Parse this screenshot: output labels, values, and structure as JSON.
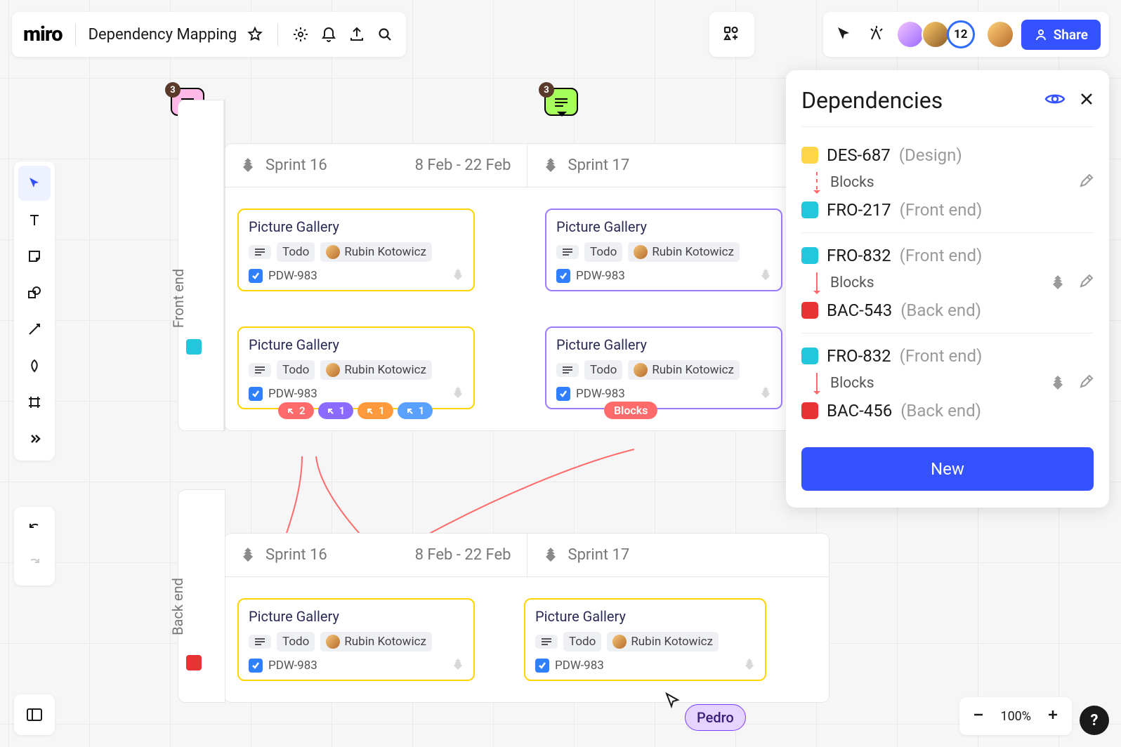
{
  "header": {
    "logo": "miro",
    "board_title": "Dependency Mapping",
    "share_label": "Share",
    "participant_overflow": "12"
  },
  "comments": [
    {
      "id": "comment-pink",
      "count": "3"
    },
    {
      "id": "comment-green",
      "count": "3"
    }
  ],
  "lanes": {
    "front_end": {
      "label": "Front end",
      "sprints": [
        {
          "name": "Sprint 16",
          "dates": "8 Feb - 22 Feb"
        },
        {
          "name": "Sprint 17",
          "dates": ""
        }
      ]
    },
    "back_end": {
      "label": "Back end",
      "sprints": [
        {
          "name": "Sprint 16",
          "dates": "8 Feb - 22 Feb"
        },
        {
          "name": "Sprint 17",
          "dates": ""
        }
      ]
    }
  },
  "cards": {
    "fe_s16_a": {
      "title": "Picture Gallery",
      "status": "Todo",
      "assignee": "Rubin Kotowicz",
      "key": "PDW-983"
    },
    "fe_s16_b": {
      "title": "Picture Gallery",
      "status": "Todo",
      "assignee": "Rubin Kotowicz",
      "key": "PDW-983",
      "pills": [
        {
          "count": "2",
          "color": "#ff6b6b"
        },
        {
          "count": "1",
          "color": "#8b6bff"
        },
        {
          "count": "1",
          "color": "#ff9a3c"
        },
        {
          "count": "1",
          "color": "#5aa0ff"
        }
      ]
    },
    "fe_s17_a": {
      "title": "Picture Gallery",
      "status": "Todo",
      "assignee": "Rubin Kotowicz",
      "key": "PDW-983"
    },
    "fe_s17_b": {
      "title": "Picture Gallery",
      "status": "Todo",
      "assignee": "Rubin Kotowicz",
      "key": "PDW-983",
      "blocks_label": "Blocks"
    },
    "be_s16_a": {
      "title": "Picture Gallery",
      "status": "Todo",
      "assignee": "Rubin Kotowicz",
      "key": "PDW-983"
    },
    "be_s17_a": {
      "title": "Picture Gallery",
      "status": "Todo",
      "assignee": "Rubin Kotowicz",
      "key": "PDW-983"
    }
  },
  "dependencies_panel": {
    "title": "Dependencies",
    "groups": [
      {
        "from": {
          "key": "DES-687",
          "category": "(Design)",
          "type": "design"
        },
        "relation": "Blocks",
        "arrow": "dashed",
        "to": {
          "key": "FRO-217",
          "category": "(Front end)",
          "type": "front"
        },
        "show_jira": false
      },
      {
        "from": {
          "key": "FRO-832",
          "category": "(Front end)",
          "type": "front"
        },
        "relation": "Blocks",
        "arrow": "solid",
        "to": {
          "key": "BAC-543",
          "category": "(Back end)",
          "type": "back"
        },
        "show_jira": true
      },
      {
        "from": {
          "key": "FRO-832",
          "category": "(Front end)",
          "type": "front"
        },
        "relation": "Blocks",
        "arrow": "solid",
        "to": {
          "key": "BAC-456",
          "category": "(Back end)",
          "type": "back"
        },
        "show_jira": true
      }
    ],
    "new_label": "New"
  },
  "remote_cursor": {
    "name": "Pedro"
  },
  "zoom": {
    "level": "100%"
  }
}
